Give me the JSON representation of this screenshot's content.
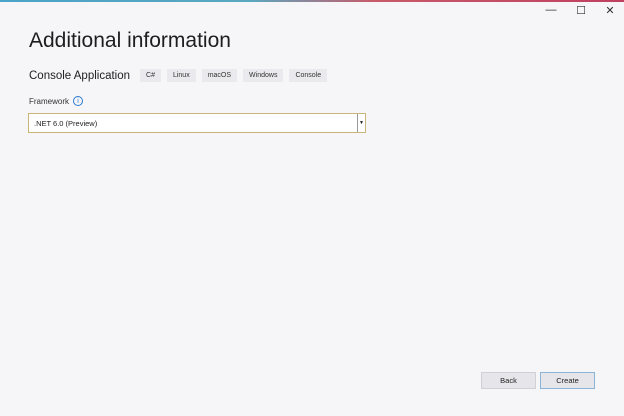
{
  "window": {
    "minimize": "—",
    "maximize": "☐",
    "close": "✕"
  },
  "title": "Additional information",
  "project": {
    "name": "Console Application",
    "tags": [
      "C#",
      "Linux",
      "macOS",
      "Windows",
      "Console"
    ]
  },
  "framework": {
    "label": "Framework",
    "info_icon": "i",
    "value": ".NET 6.0 (Preview)",
    "arrow": "▼"
  },
  "buttons": {
    "back": "Back",
    "create": "Create"
  }
}
